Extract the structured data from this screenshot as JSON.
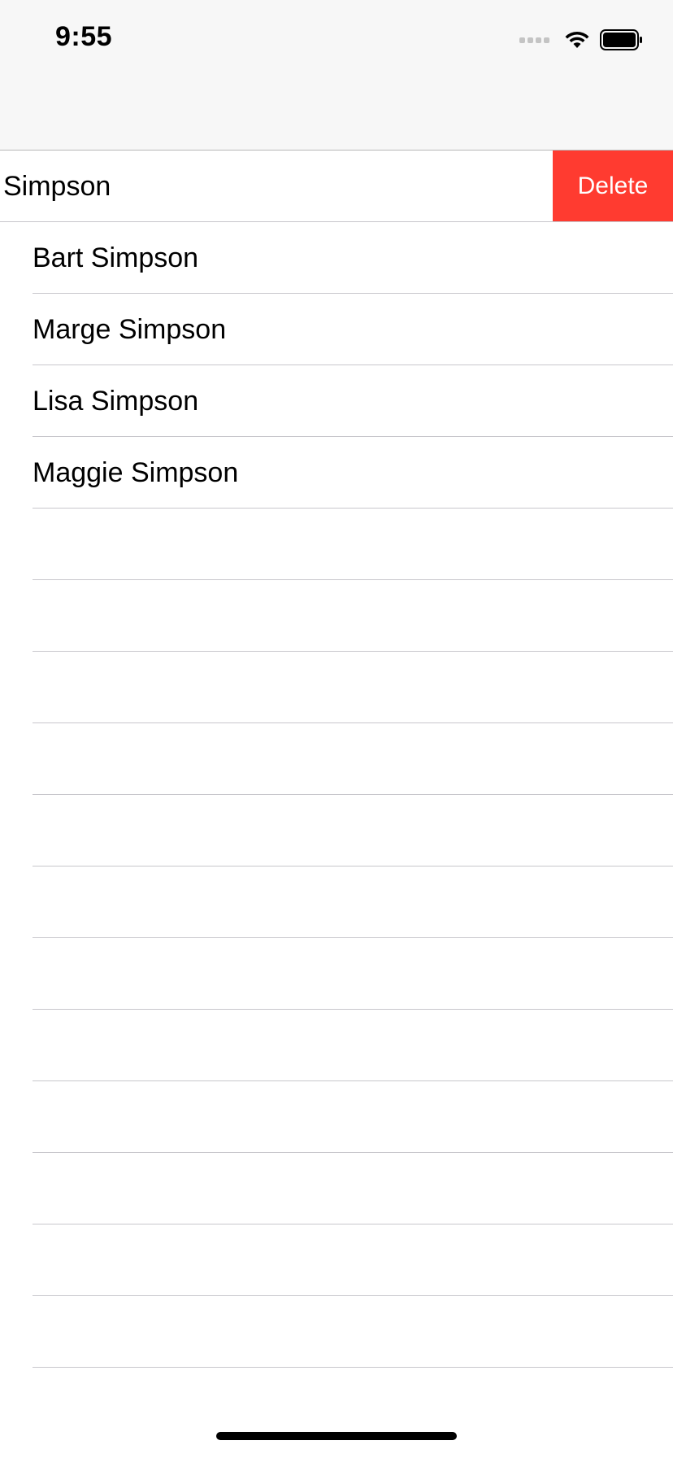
{
  "status_bar": {
    "time": "9:55"
  },
  "swiped_row": {
    "label": "Simpson",
    "action_label": "Delete",
    "action_color": "#ff3b30"
  },
  "rows": [
    {
      "label": "Bart Simpson"
    },
    {
      "label": "Marge Simpson"
    },
    {
      "label": "Lisa Simpson"
    },
    {
      "label": "Maggie Simpson"
    }
  ],
  "empty_rows": 12,
  "icons": [
    "signal-icon",
    "wifi-icon",
    "battery-icon"
  ]
}
